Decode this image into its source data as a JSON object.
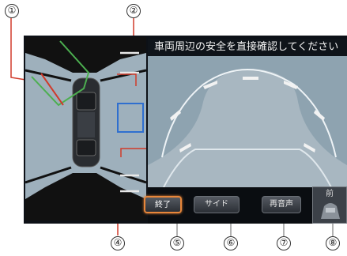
{
  "screen": {
    "banner_text": "車両周辺の安全を直接確認してください",
    "buttons": {
      "end": "終了",
      "side": "サイド",
      "voice": "再音声",
      "front": "前"
    }
  },
  "callouts": [
    "①",
    "②",
    "④",
    "⑤",
    "⑥",
    "⑦",
    "⑧"
  ],
  "colors": {
    "button_highlight": "#e7863a",
    "guide_green": "#4caf50",
    "guide_red": "#d03a2a",
    "guide_blue": "#2f6fcf"
  }
}
